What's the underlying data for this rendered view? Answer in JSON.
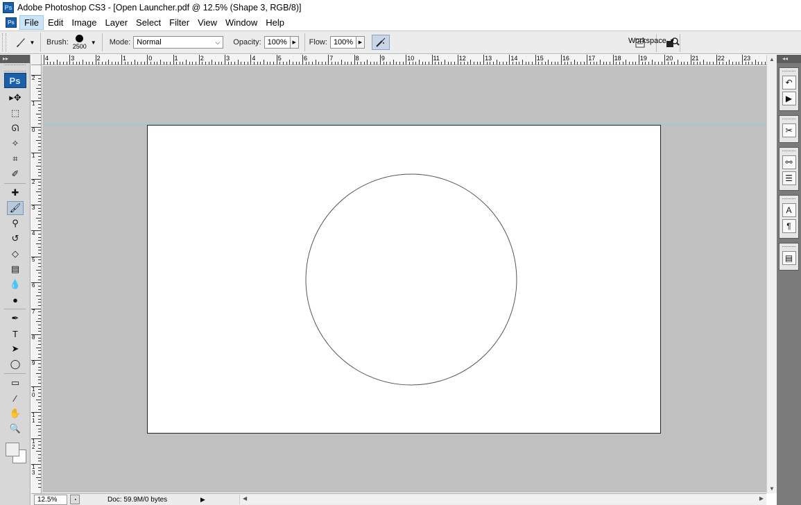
{
  "window": {
    "title": "Adobe Photoshop CS3 - [Open Launcher.pdf @ 12.5% (Shape 3, RGB/8)]",
    "app_icon": "Ps"
  },
  "menu": {
    "items": [
      "File",
      "Edit",
      "Image",
      "Layer",
      "Select",
      "Filter",
      "View",
      "Window",
      "Help"
    ],
    "active": "File"
  },
  "options": {
    "brush_label": "Brush:",
    "brush_size": "2500",
    "mode_label": "Mode:",
    "mode_value": "Normal",
    "opacity_label": "Opacity:",
    "opacity_value": "100%",
    "flow_label": "Flow:",
    "flow_value": "100%",
    "workspace_label": "Workspace"
  },
  "toolbox": {
    "logo": "Ps",
    "tools": [
      {
        "name": "move-tool",
        "glyph": "▸✥"
      },
      {
        "name": "marquee-tool",
        "glyph": "⬚"
      },
      {
        "name": "lasso-tool",
        "glyph": "ᘏ"
      },
      {
        "name": "magic-wand-tool",
        "glyph": "✧"
      },
      {
        "name": "crop-tool",
        "glyph": "⌗"
      },
      {
        "name": "slice-tool",
        "glyph": "✐"
      },
      {
        "name": "healing-brush-tool",
        "glyph": "✚"
      },
      {
        "name": "brush-tool",
        "glyph": "🖌",
        "selected": true
      },
      {
        "name": "clone-stamp-tool",
        "glyph": "⚲"
      },
      {
        "name": "history-brush-tool",
        "glyph": "↺"
      },
      {
        "name": "eraser-tool",
        "glyph": "◇"
      },
      {
        "name": "gradient-tool",
        "glyph": "▤"
      },
      {
        "name": "blur-tool",
        "glyph": "💧"
      },
      {
        "name": "dodge-tool",
        "glyph": "●"
      },
      {
        "name": "pen-tool",
        "glyph": "✒"
      },
      {
        "name": "type-tool",
        "glyph": "T"
      },
      {
        "name": "path-selection-tool",
        "glyph": "➤"
      },
      {
        "name": "ellipse-tool",
        "glyph": "◯"
      },
      {
        "name": "notes-tool",
        "glyph": "▭"
      },
      {
        "name": "eyedropper-tool",
        "glyph": "⁄"
      },
      {
        "name": "hand-tool",
        "glyph": "✋"
      },
      {
        "name": "zoom-tool",
        "glyph": "🔍"
      }
    ]
  },
  "rulers": {
    "top_labels": [
      "4",
      "3",
      "2",
      "1",
      "0",
      "1",
      "2",
      "3",
      "4",
      "5",
      "6",
      "7",
      "8",
      "9",
      "10",
      "11",
      "12",
      "13",
      "14",
      "15",
      "16",
      "17",
      "18",
      "19",
      "20",
      "21",
      "22",
      "23"
    ],
    "left_labels": [
      "2",
      "1",
      "0",
      "1",
      "2",
      "3",
      "4",
      "5",
      "6",
      "7",
      "8",
      "9",
      "1 0",
      "1 1",
      "1 2",
      "1 3"
    ]
  },
  "status": {
    "zoom": "12.5%",
    "doc_info": "Doc: 59.9M/0 bytes"
  },
  "dock": {
    "groups": [
      [
        "history-icon",
        "actions-icon"
      ],
      [
        "tools-presets-icon"
      ],
      [
        "layer-comps-icon",
        "channels-icon"
      ],
      [
        "character-icon",
        "paragraph-icon"
      ],
      [
        "info-icon"
      ]
    ]
  },
  "colors": {
    "canvas_bg": "#c0c0c0",
    "guide": "#7fd6d6",
    "selected_tool": "#b9c9dc"
  }
}
